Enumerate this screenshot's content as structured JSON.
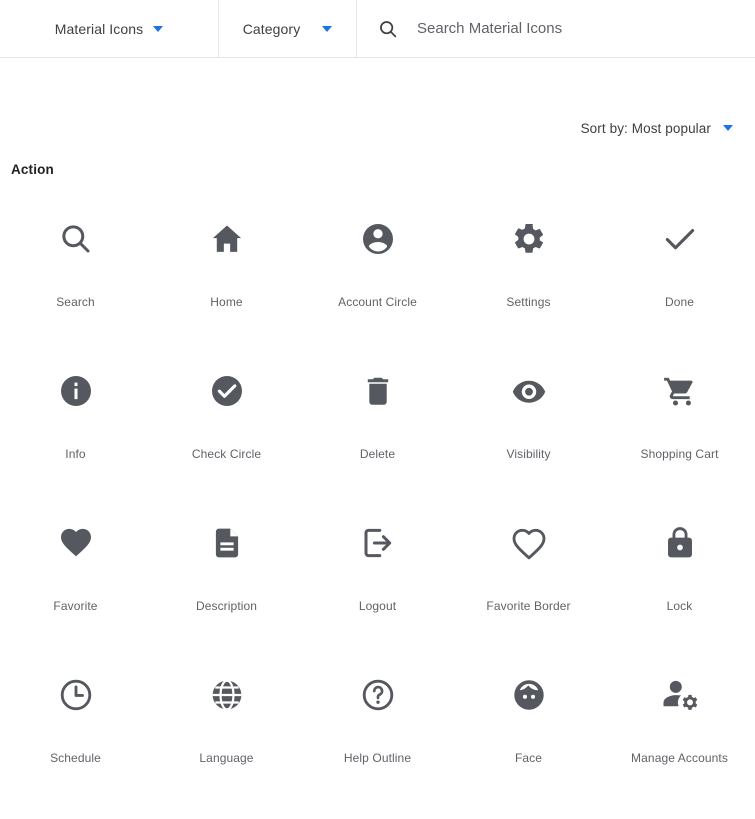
{
  "header": {
    "library_select": {
      "label": "Material Icons",
      "icon": "chevron-down-icon"
    },
    "category_select": {
      "label": "Category",
      "icon": "chevron-down-icon"
    },
    "search": {
      "icon": "search-icon",
      "value": "",
      "placeholder": "Search Material Icons"
    }
  },
  "toolbar": {
    "sort_label": "Sort by: Most popular",
    "sort_caret": "chevron-down-icon"
  },
  "colors": {
    "accent_blue": "#1a73e8",
    "icon_gray": "#55595f",
    "label_gray": "#5f6368",
    "divider": "#e4e6e8",
    "background": "#ffffff"
  },
  "section": {
    "title": "Action",
    "icons": [
      {
        "label": "Search",
        "icon": "search-icon"
      },
      {
        "label": "Home",
        "icon": "home-icon"
      },
      {
        "label": "Account Circle",
        "icon": "account-circle-icon"
      },
      {
        "label": "Settings",
        "icon": "settings-gear-icon"
      },
      {
        "label": "Done",
        "icon": "check-icon"
      },
      {
        "label": "Info",
        "icon": "info-icon"
      },
      {
        "label": "Check Circle",
        "icon": "check-circle-icon"
      },
      {
        "label": "Delete",
        "icon": "trash-icon"
      },
      {
        "label": "Visibility",
        "icon": "eye-icon"
      },
      {
        "label": "Shopping Cart",
        "icon": "shopping-cart-icon"
      },
      {
        "label": "Favorite",
        "icon": "heart-filled-icon"
      },
      {
        "label": "Description",
        "icon": "document-icon"
      },
      {
        "label": "Logout",
        "icon": "logout-icon"
      },
      {
        "label": "Favorite Border",
        "icon": "heart-outline-icon"
      },
      {
        "label": "Lock",
        "icon": "lock-icon"
      },
      {
        "label": "Schedule",
        "icon": "clock-icon"
      },
      {
        "label": "Language",
        "icon": "globe-icon"
      },
      {
        "label": "Help Outline",
        "icon": "help-outline-icon"
      },
      {
        "label": "Face",
        "icon": "face-icon"
      },
      {
        "label": "Manage Accounts",
        "icon": "manage-accounts-icon"
      }
    ]
  }
}
